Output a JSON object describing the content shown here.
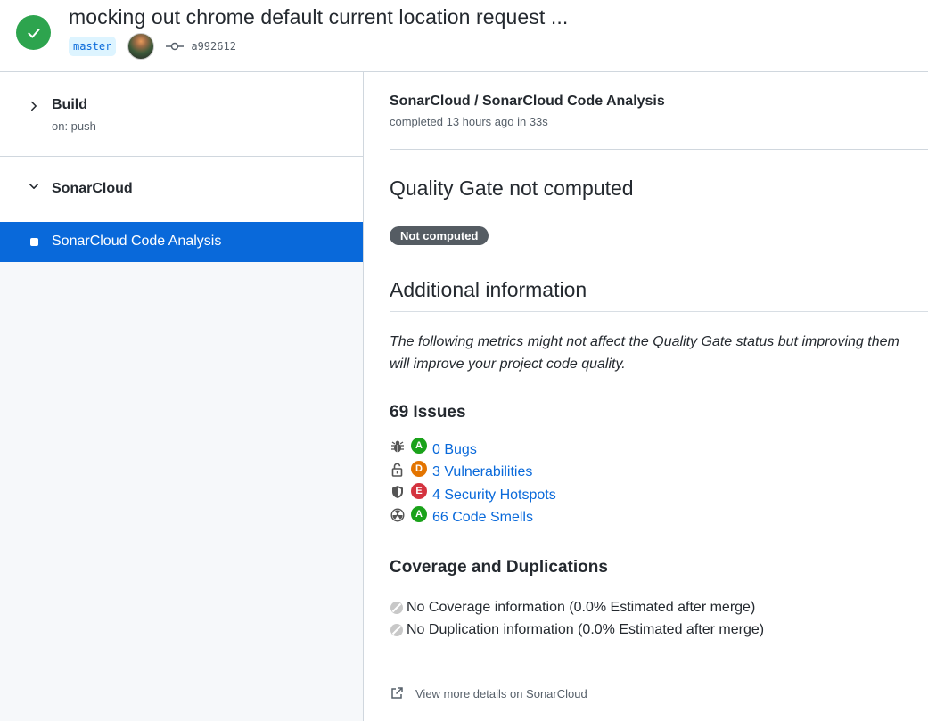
{
  "header": {
    "title": "mocking out chrome default current location request ...",
    "branch": "master",
    "commit_sha": "a992612",
    "status": "success"
  },
  "sidebar": {
    "workflows": [
      {
        "name": "Build",
        "trigger": "on: push",
        "expanded": false
      },
      {
        "name": "SonarCloud",
        "expanded": true
      }
    ],
    "jobs": [
      {
        "label": "SonarCloud Code Analysis",
        "selected": true
      }
    ]
  },
  "main": {
    "check_title": "SonarCloud / SonarCloud Code Analysis",
    "check_status": "completed 13 hours ago in 33s",
    "quality_gate_heading": "Quality Gate not computed",
    "quality_gate_badge": "Not computed",
    "additional_heading": "Additional information",
    "note": "The following metrics might not affect the Quality Gate status but improving them will improve your project code quality.",
    "issues_heading": "69 Issues",
    "issues": [
      {
        "icon": "bug-icon",
        "rating": "A",
        "rating_color": "#1aa21a",
        "label": "0 Bugs"
      },
      {
        "icon": "unlocked-icon",
        "rating": "D",
        "rating_color": "#e37400",
        "label": "3 Vulnerabilities"
      },
      {
        "icon": "shield-icon",
        "rating": "E",
        "rating_color": "#d4333f",
        "label": "4 Security Hotspots"
      },
      {
        "icon": "radiation-icon",
        "rating": "A",
        "rating_color": "#1aa21a",
        "label": "66 Code Smells"
      }
    ],
    "coverage_heading": "Coverage and Duplications",
    "coverage": [
      {
        "label": "No Coverage information (0.0% Estimated after merge)"
      },
      {
        "label": "No Duplication information (0.0% Estimated after merge)"
      }
    ],
    "more_link": "View more details on SonarCloud"
  },
  "colors": {
    "success": "#2da44e",
    "selected": "#0969da",
    "link": "#0969da"
  }
}
